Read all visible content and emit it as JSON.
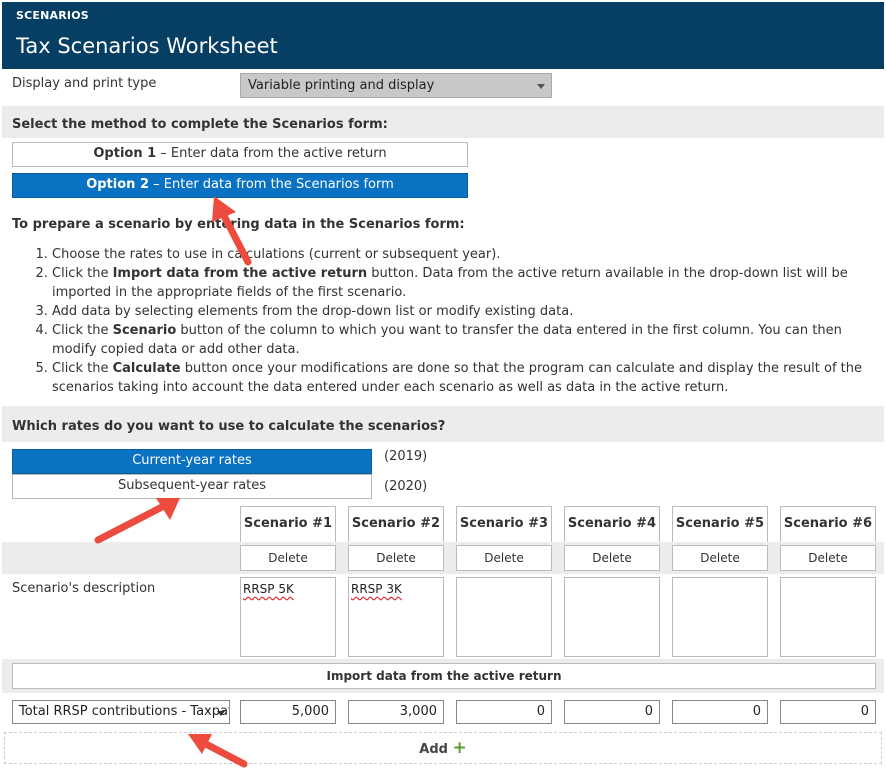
{
  "header": {
    "kicker": "SCENARIOS",
    "title": "Tax Scenarios Worksheet"
  },
  "display": {
    "label": "Display and print type",
    "value": "Variable printing and display"
  },
  "method": {
    "heading": "Select the method to complete the Scenarios form:",
    "option1_bold": "Option 1",
    "option1_text": " – Enter data from the active return",
    "option2_bold": "Option 2",
    "option2_text": " – Enter data from the Scenarios form"
  },
  "prepare": {
    "heading": "To prepare a scenario by entering data in the Scenarios form:",
    "steps": [
      {
        "a": "Choose the rates to use in calculations (current or subsequent year).",
        "b": "",
        "c": ""
      },
      {
        "a": "Click the ",
        "b": "Import data from the active return",
        "c": " button. Data from the active return available in the drop-down list will be imported in the appropriate fields of the first scenario."
      },
      {
        "a": "Add data by selecting elements from the drop-down list or modify existing data.",
        "b": "",
        "c": ""
      },
      {
        "a": "Click the ",
        "b": "Scenario",
        "c": " button of the column to which you want to transfer the data entered in the first column. You can then modify copied data or add other data."
      },
      {
        "a": "Click the ",
        "b": "Calculate",
        "c": " button once your modifications are done so that the program can calculate and display the result of the scenarios taking into account the data entered under each scenario as well as data in the active return."
      }
    ]
  },
  "rates": {
    "heading": "Which rates do you want to use to calculate the scenarios?",
    "current_label": "Current-year rates",
    "current_year": "(2019)",
    "subsequent_label": "Subsequent-year rates",
    "subsequent_year": "(2020)"
  },
  "scenarios": {
    "headers": [
      "Scenario #1",
      "Scenario #2",
      "Scenario #3",
      "Scenario #4",
      "Scenario #5",
      "Scenario #6"
    ],
    "delete_label": "Delete",
    "desc_label": "Scenario's description",
    "descriptions": [
      "RRSP 5K",
      "RRSP 3K",
      "",
      "",
      "",
      ""
    ],
    "import_label": "Import data from the active return",
    "field_label": "Total RRSP contributions - Taxpayer",
    "values": [
      "5,000",
      "3,000",
      "0",
      "0",
      "0",
      "0"
    ],
    "add_label": "Add",
    "add_icon": "+"
  },
  "colors": {
    "header": "#073e64",
    "selected": "#0a72c2",
    "arrow": "#ec4b3e",
    "add_plus": "#5a9e2f"
  }
}
